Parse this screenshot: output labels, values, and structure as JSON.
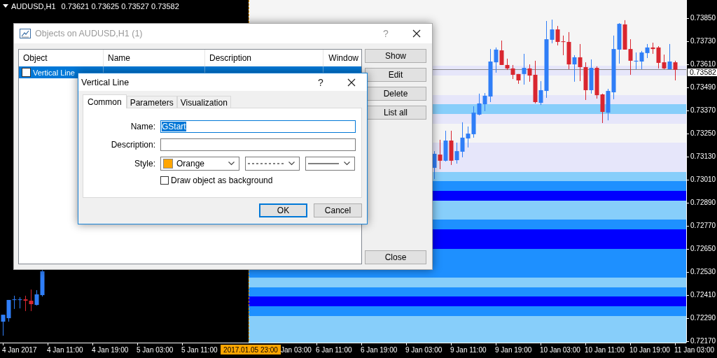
{
  "chart": {
    "symbol": "AUDUSD,H1",
    "ohlc": "0.73621 0.73625 0.73527 0.73582",
    "chart_data": {
      "type": "candlestick",
      "ylim": [
        0.72163,
        0.73945
      ],
      "categories": [
        null,
        null,
        null,
        null,
        null,
        null,
        null,
        null,
        null,
        null,
        null,
        null,
        null,
        null,
        null,
        null,
        null,
        null,
        null,
        null,
        null,
        null,
        null,
        null,
        null,
        null,
        null,
        null,
        null,
        null,
        null,
        null,
        null,
        null,
        null,
        null,
        null,
        null,
        null,
        null,
        null,
        null,
        null,
        null,
        null,
        null,
        null,
        null,
        null,
        null,
        null,
        null,
        null,
        null,
        null,
        null,
        null,
        null,
        null,
        null,
        null,
        null,
        null,
        null,
        null,
        null,
        null,
        null,
        null,
        null,
        null,
        null,
        null,
        null,
        null,
        null,
        null,
        null,
        null,
        null,
        null,
        null,
        null,
        null,
        null,
        null,
        null,
        null,
        null,
        null,
        null,
        null,
        null,
        null,
        null,
        null,
        null,
        null,
        null,
        null,
        null,
        null,
        null,
        null,
        null,
        null,
        null,
        null,
        null,
        null,
        null,
        null,
        null,
        null,
        null,
        null,
        null,
        null,
        null,
        null,
        null
      ],
      "yticks": [
        {
          "value": 0.7385,
          "label": "0.73850"
        },
        {
          "value": 0.7373,
          "label": "0.73730"
        },
        {
          "value": 0.7361,
          "label": "0.73610"
        },
        {
          "value": 0.7349,
          "label": "0.73490"
        },
        {
          "value": 0.7337,
          "label": "0.73370"
        },
        {
          "value": 0.7325,
          "label": "0.73250"
        },
        {
          "value": 0.7313,
          "label": "0.73130"
        },
        {
          "value": 0.7301,
          "label": "0.73010"
        },
        {
          "value": 0.7289,
          "label": "0.72890"
        },
        {
          "value": 0.7277,
          "label": "0.72770"
        },
        {
          "value": 0.7265,
          "label": "0.72650"
        },
        {
          "value": 0.7253,
          "label": "0.72530"
        },
        {
          "value": 0.7241,
          "label": "0.72410"
        },
        {
          "value": 0.7229,
          "label": "0.72290"
        },
        {
          "value": 0.7217,
          "label": "0.72170"
        }
      ],
      "ohlc": [
        [
          0.72272,
          0.72308,
          0.72199,
          0.72308
        ],
        [
          0.7229,
          0.72385,
          0.72272,
          0.72385
        ],
        [
          0.72385,
          0.72407,
          0.72338,
          0.72388
        ],
        [
          0.72385,
          0.72399,
          0.72341,
          0.72388
        ],
        [
          0.72388,
          0.72407,
          0.72327,
          0.72381
        ],
        [
          0.72381,
          0.72439,
          0.72327,
          0.72363
        ],
        [
          0.72359,
          0.72436,
          0.72356,
          0.72414
        ],
        [
          0.7241,
          0.72541,
          0.72403,
          0.72534
        ],
        null,
        null,
        null,
        null,
        null,
        null,
        null,
        null,
        null,
        null,
        null,
        null,
        null,
        null,
        null,
        null,
        null,
        null,
        null,
        null,
        null,
        null,
        null,
        null,
        null,
        null,
        null,
        null,
        null,
        null,
        null,
        null,
        null,
        null,
        null,
        null,
        null,
        null,
        null,
        null,
        null,
        null,
        null,
        null,
        null,
        null,
        null,
        null,
        null,
        null,
        null,
        null,
        null,
        null,
        null,
        null,
        null,
        null,
        null,
        null,
        null,
        null,
        null,
        null,
        null,
        null,
        null,
        null,
        null,
        [
          0.73072,
          0.73159,
          0.73014,
          0.73145
        ],
        [
          0.73141,
          0.73218,
          0.73065,
          0.73109
        ],
        [
          0.73109,
          0.73265,
          0.73105,
          0.73214
        ],
        [
          0.73214,
          0.73265,
          0.73087,
          0.73109
        ],
        [
          0.73112,
          0.73203,
          0.73094,
          0.73159
        ],
        [
          0.73156,
          0.73309,
          0.73127,
          0.73229
        ],
        [
          0.73225,
          0.73287,
          0.73178,
          0.7325
        ],
        [
          0.73247,
          0.73392,
          0.73229,
          0.73359
        ],
        [
          0.73349,
          0.73458,
          0.73345,
          0.73407
        ],
        [
          0.73403,
          0.73461,
          0.73367,
          0.73447
        ],
        [
          0.73443,
          0.7369,
          0.73414,
          0.73625
        ],
        [
          0.73621,
          0.73698,
          0.73567,
          0.73687
        ],
        [
          0.73683,
          0.73734,
          0.73607,
          0.73607
        ],
        [
          0.73607,
          0.7364,
          0.73581,
          0.73589
        ],
        [
          0.73589,
          0.73607,
          0.73534,
          0.73556
        ],
        [
          0.7356,
          0.7356,
          0.73509,
          0.73527
        ],
        [
          0.7356,
          0.73665,
          0.73505,
          0.73592
        ],
        [
          0.73589,
          0.7361,
          0.7352,
          0.73552
        ],
        [
          0.73556,
          0.73629,
          0.73407,
          0.73414
        ],
        [
          0.7341,
          0.73523,
          0.73399,
          0.73476
        ],
        [
          0.73472,
          0.73836,
          0.73436,
          0.73741
        ],
        [
          0.73738,
          0.73843,
          0.7372,
          0.73792
        ],
        [
          0.73792,
          0.7381,
          0.73709,
          0.73727
        ],
        [
          0.7373,
          0.7376,
          0.73658,
          0.73727
        ],
        [
          0.73727,
          0.73778,
          0.73585,
          0.7361
        ],
        [
          0.7361,
          0.73658,
          0.7352,
          0.73647
        ],
        [
          0.73647,
          0.73716,
          0.73523,
          0.73596
        ],
        [
          0.73596,
          0.73621,
          0.73425,
          0.73476
        ],
        [
          0.73476,
          0.73636,
          0.73458,
          0.73592
        ],
        [
          0.73592,
          0.736,
          0.73432,
          0.7345
        ],
        [
          0.73454,
          0.73458,
          0.73305,
          0.73363
        ],
        [
          0.73359,
          0.73483,
          0.73319,
          0.73472
        ],
        [
          0.73465,
          0.7376,
          0.73429,
          0.7369
        ],
        [
          0.73687,
          0.73825,
          0.73614,
          0.73821
        ],
        [
          0.73818,
          0.7384,
          0.73687,
          0.73687
        ],
        [
          0.7369,
          0.73741,
          0.73556,
          0.73629
        ],
        [
          0.73625,
          0.73672,
          0.73585,
          0.73629
        ],
        [
          0.73625,
          0.7368,
          0.73585,
          0.73672
        ],
        [
          0.73669,
          0.73716,
          0.73643,
          0.73698
        ],
        [
          0.73698,
          0.73723,
          0.73665,
          0.7369
        ],
        [
          0.73698,
          0.73705,
          0.73589,
          0.73618
        ],
        [
          0.73621,
          0.73661,
          0.73585,
          0.73589
        ],
        [
          0.73585,
          0.73716,
          0.73585,
          0.73625
        ],
        [
          0.73621,
          0.73629,
          0.73527,
          0.73582
        ]
      ]
    }
  },
  "price_axis": {
    "current_price": "0.73582"
  },
  "time_axis": {
    "labels": [
      {
        "text": "4 Jan 2017",
        "kind": "tick"
      },
      {
        "text": "4 Jan 11:00",
        "kind": "tick"
      },
      {
        "text": "4 Jan 19:00",
        "kind": "tick"
      },
      {
        "text": "5 Jan 03:00",
        "kind": "tick"
      },
      {
        "text": "5 Jan 11:00",
        "kind": "tick"
      },
      {
        "text": "2017.01.05 23:00",
        "kind": "cursor"
      },
      {
        "text": "Jan 03:00",
        "kind": "partial"
      },
      {
        "text": "6 Jan 11:00",
        "kind": "tick"
      },
      {
        "text": "6 Jan 19:00",
        "kind": "tick"
      },
      {
        "text": "9 Jan 03:00",
        "kind": "tick"
      },
      {
        "text": "9 Jan 11:00",
        "kind": "tick"
      },
      {
        "text": "9 Jan 19:00",
        "kind": "tick"
      },
      {
        "text": "10 Jan 03:00",
        "kind": "tick"
      },
      {
        "text": "10 Jan 11:00",
        "kind": "tick"
      },
      {
        "text": "10 Jan 19:00",
        "kind": "tick"
      },
      {
        "text": "11 Jan 03:00",
        "kind": "tick"
      }
    ]
  },
  "objects_dialog": {
    "title": "Objects on AUDUSD,H1 (1)",
    "active": false,
    "help": "?",
    "columns": [
      "Object",
      "Name",
      "Description",
      "Window"
    ],
    "rows": [
      {
        "object": "Vertical Line",
        "checked": false,
        "selected": true
      }
    ],
    "buttons": [
      "Show",
      "Edit",
      "Delete",
      "List all"
    ],
    "close_button": "Close"
  },
  "line_dialog": {
    "title": "Vertical Line",
    "active": true,
    "help": "?",
    "tabs": [
      {
        "label": "Common",
        "selected": true
      },
      {
        "label": "Parameters",
        "selected": false
      },
      {
        "label": "Visualization",
        "selected": false
      }
    ],
    "fields": [
      {
        "label": "Name:",
        "value": "GStart",
        "focused": true
      },
      {
        "label": "Description:",
        "focused": false
      }
    ],
    "style": {
      "label": "Style:",
      "color_name": "Orange",
      "color": "#ffa500"
    },
    "background_checkbox": {
      "label": "Draw object as background",
      "checked": false
    },
    "buttons": [
      {
        "label": "OK",
        "default": true
      },
      {
        "label": "Cancel",
        "default": false
      }
    ]
  }
}
